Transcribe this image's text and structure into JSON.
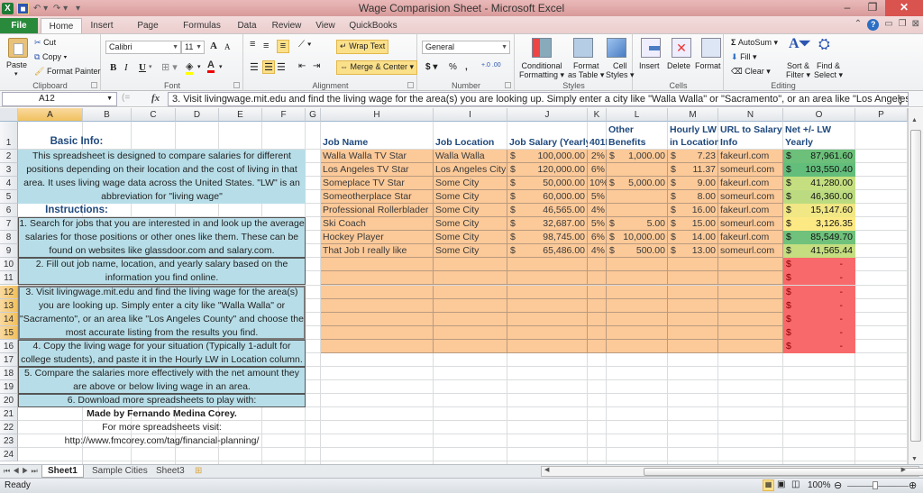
{
  "window": {
    "title": "Wage Comparision Sheet  -  Microsoft Excel",
    "controls": {
      "minimize": "–",
      "restore": "❐",
      "close": "✕"
    }
  },
  "quick_access": {
    "app_icon": "X",
    "save_icon": "■",
    "undo": "↶ ▾",
    "redo": "↷ ▾",
    "customize": "▾"
  },
  "ribbon_tabs": [
    "File",
    "Home",
    "Insert",
    "Page Layout",
    "Formulas",
    "Data",
    "Review",
    "View",
    "QuickBooks"
  ],
  "active_tab": "Home",
  "ribbon": {
    "clipboard": {
      "label": "Clipboard",
      "paste": "Paste",
      "cut": "Cut",
      "copy": "Copy",
      "format_painter": "Format Painter"
    },
    "font": {
      "label": "Font",
      "font_name": "Calibri",
      "font_size": "11",
      "bold": "B",
      "italic": "I",
      "underline": "U",
      "grow": "A",
      "shrink": "A",
      "fill_color": "#ffff00",
      "font_color": "#ff0000"
    },
    "alignment": {
      "label": "Alignment",
      "wrap_text": "Wrap Text",
      "merge_center": "Merge & Center"
    },
    "number": {
      "label": "Number",
      "format": "General",
      "currency": "$",
      "percent": "%",
      "comma": ",",
      "inc_decimal": "+.0 .00",
      "dec_decimal": ".00 →.0"
    },
    "styles": {
      "label": "Styles",
      "conditional": [
        "Conditional",
        "Formatting ▾"
      ],
      "format_table": [
        "Format",
        "as Table ▾"
      ],
      "cell_styles": [
        "Cell",
        "Styles ▾"
      ]
    },
    "cells": {
      "label": "Cells",
      "insert": "Insert",
      "delete": "Delete",
      "format": "Format"
    },
    "editing": {
      "label": "Editing",
      "autosum": "AutoSum ▾",
      "fill": "Fill ▾",
      "clear": "Clear ▾",
      "sort": [
        "Sort &",
        "Filter ▾"
      ],
      "find": [
        "Find &",
        "Select ▾"
      ]
    }
  },
  "formula_bar": {
    "name_box": "A12",
    "fx": "fx",
    "content": "3. Visit livingwage.mit.edu and find the living wage for the area(s) you are looking up. Simply enter a city like \"Walla Walla\" or \"Sacramento\", or an area like \"Los Angeles"
  },
  "columns": [
    "A",
    "B",
    "C",
    "D",
    "E",
    "F",
    "G",
    "H",
    "I",
    "J",
    "K",
    "L",
    "M",
    "N",
    "O",
    "P"
  ],
  "selected_column": "A",
  "rows": [
    "1",
    "2",
    "3",
    "4",
    "5",
    "6",
    "7",
    "8",
    "9",
    "10",
    "11",
    "12",
    "13",
    "14",
    "15",
    "16",
    "17",
    "18",
    "19",
    "20",
    "21",
    "22",
    "23",
    "24"
  ],
  "selected_rows": [
    "12",
    "13",
    "14",
    "15"
  ],
  "left_panel": {
    "basic_info_title": "Basic Info:",
    "basic_info_lines": [
      "This spreadsheet is designed to compare salaries for different",
      "positions depending on their location and the cost of living in that",
      "area. It uses living wage data across the United States. \"LW\" is an",
      "abbreviation for \"living wage\""
    ],
    "instructions_title": "Instructions:",
    "steps": [
      [
        "1. Search for jobs that you are interested in and look up the average",
        "salaries for those positions or other ones like them. These can be",
        "found on websites like glassdoor.com and salary.com."
      ],
      [
        "2. Fill out job name, location, and yearly salary based on the",
        "information you find online."
      ],
      [
        "3. Visit livingwage.mit.edu and find the living wage for the area(s)",
        "you are looking up. Simply enter a city like \"Walla Walla\" or",
        "\"Sacramento\", or an area like \"Los Angeles County\" and choose the",
        "most accurate listing from the results you find."
      ],
      [
        "4. Copy the living wage for your situation (Typically 1-adult for",
        "college students), and paste it in the Hourly LW in Location column."
      ],
      [
        "5. Compare the salaries more effectively with the net amount they",
        "are above or below living wage in an area."
      ],
      [
        "6. Download more spreadsheets to play with:"
      ]
    ],
    "made_by": "Made by Fernando Medina Corey.",
    "more": "For more spreadsheets visit:",
    "url": "http://www.fmcorey.com/tag/financial-planning/"
  },
  "table": {
    "headers": {
      "job_name": "Job Name",
      "job_location": "Job Location",
      "job_salary": "Job Salary (Yearly)",
      "k401": "401K",
      "other_benefits": [
        "Other",
        "Benefits"
      ],
      "hourly_lw": [
        "Hourly LW",
        "in Location"
      ],
      "url": [
        "URL to Salary",
        "Info"
      ],
      "net": [
        "Net +/- LW",
        "Yearly"
      ]
    },
    "rows": [
      {
        "job": "Walla Walla TV Star",
        "location": "Walla Walla",
        "salary": "100,000.00",
        "k401": "2%",
        "benefits": "1,000.00",
        "hourly": "7.23",
        "url": "fakeurl.com",
        "net": "87,961.60",
        "net_color": "#6cc07a"
      },
      {
        "job": "Los Angeles TV Star",
        "location": "Los Angeles City",
        "salary": "120,000.00",
        "k401": "6%",
        "benefits": "",
        "hourly": "11.37",
        "url": "someurl.com",
        "net": "103,550.40",
        "net_color": "#63be7b"
      },
      {
        "job": "Someplace TV Star",
        "location": "Some City",
        "salary": "50,000.00",
        "k401": "10%",
        "benefits": "5,000.00",
        "hourly": "9.00",
        "url": "fakeurl.com",
        "net": "41,280.00",
        "net_color": "#c5df80"
      },
      {
        "job": "Someotherplace Star",
        "location": "Some City",
        "salary": "60,000.00",
        "k401": "5%",
        "benefits": "",
        "hourly": "8.00",
        "url": "someurl.com",
        "net": "46,360.00",
        "net_color": "#bcdb80"
      },
      {
        "job": "Professional Rollerblader",
        "location": "Some City",
        "salary": "46,565.00",
        "k401": "4%",
        "benefits": "",
        "hourly": "16.00",
        "url": "fakeurl.com",
        "net": "15,147.60",
        "net_color": "#f1e784"
      },
      {
        "job": "Ski Coach",
        "location": "Some City",
        "salary": "32,687.00",
        "k401": "5%",
        "benefits": "5.00",
        "hourly": "15.00",
        "url": "someurl.com",
        "net": "3,126.35",
        "net_color": "#fde984"
      },
      {
        "job": "Hockey Player",
        "location": "Some City",
        "salary": "98,745.00",
        "k401": "6%",
        "benefits": "10,000.00",
        "hourly": "14.00",
        "url": "fakeurl.com",
        "net": "85,549.70",
        "net_color": "#6fc17b"
      },
      {
        "job": "That Job I really like",
        "location": "Some City",
        "salary": "65,486.00",
        "k401": "4%",
        "benefits": "500.00",
        "hourly": "13.00",
        "url": "someurl.com",
        "net": "41,565.44",
        "net_color": "#c4de80"
      }
    ],
    "empty_rows": 7,
    "empty_net": "-",
    "empty_net_color": "#f8696b",
    "currency": "$"
  },
  "sheet_tabs": [
    "Sheet1",
    "Sample Cities",
    "Sheet3"
  ],
  "active_sheet": "Sheet1",
  "status": {
    "ready": "Ready",
    "zoom": "100%"
  }
}
